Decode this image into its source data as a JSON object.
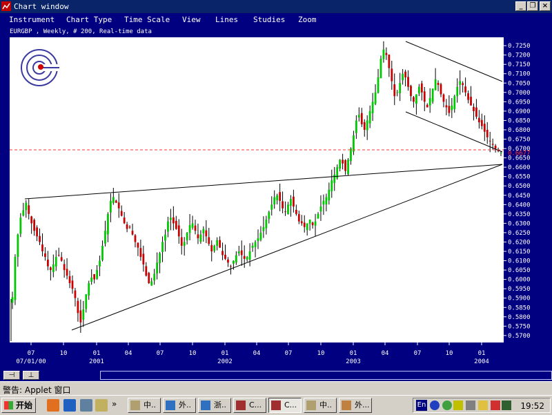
{
  "window": {
    "title": "Chart window"
  },
  "menu": [
    "Instrument",
    "Chart Type",
    "Time Scale",
    "View",
    "Lines",
    "Studies",
    "Zoom"
  ],
  "chart_info": "EURGBP , Weekly, # 200, Real-time data",
  "chart_data": {
    "type": "candlestick",
    "instrument": "EURGBP",
    "period": "Weekly",
    "bars": 200,
    "ylim": [
      0.567,
      0.728
    ],
    "y_ticks": [
      "0.7250",
      "0.7200",
      "0.7150",
      "0.7100",
      "0.7050",
      "0.7000",
      "0.6950",
      "0.6900",
      "0.6850",
      "0.6800",
      "0.6750",
      "0.6700",
      "0.6650",
      "0.6600",
      "0.6550",
      "0.6500",
      "0.6450",
      "0.6400",
      "0.6350",
      "0.6300",
      "0.6250",
      "0.6200",
      "0.6150",
      "0.6100",
      "0.6050",
      "0.6000",
      "0.5950",
      "0.5900",
      "0.5850",
      "0.5800",
      "0.5750",
      "0.5700"
    ],
    "x_ticks": [
      "07",
      "10",
      "01",
      "04",
      "07",
      "10",
      "01",
      "04",
      "07",
      "10",
      "01",
      "04",
      "07",
      "10",
      "01"
    ],
    "x_major": [
      "07/01/00",
      "2001",
      "2002",
      "2003",
      "2004"
    ],
    "current_price": "0.6677",
    "current_price_color": "#ff3030",
    "up_color": "#00c800",
    "down_color": "#c80000",
    "trendlines": "upper resistance, rising support, falling channel (2003-2004)",
    "closes": [
      0.5905,
      0.612,
      0.624,
      0.633,
      0.637,
      0.641,
      0.635,
      0.63,
      0.626,
      0.623,
      0.62,
      0.615,
      0.612,
      0.607,
      0.605,
      0.608,
      0.612,
      0.613,
      0.61,
      0.605,
      0.602,
      0.598,
      0.595,
      0.59,
      0.582,
      0.577,
      0.584,
      0.592,
      0.598,
      0.601,
      0.6,
      0.605,
      0.61,
      0.618,
      0.626,
      0.635,
      0.642,
      0.644,
      0.641,
      0.638,
      0.634,
      0.63,
      0.627,
      0.628,
      0.624,
      0.62,
      0.617,
      0.612,
      0.608,
      0.602,
      0.598,
      0.599,
      0.603,
      0.609,
      0.614,
      0.62,
      0.624,
      0.631,
      0.633,
      0.63,
      0.627,
      0.623,
      0.618,
      0.62,
      0.625,
      0.629,
      0.63,
      0.626,
      0.622,
      0.624,
      0.627,
      0.623,
      0.619,
      0.615,
      0.618,
      0.621,
      0.617,
      0.613,
      0.611,
      0.609,
      0.607,
      0.61,
      0.613,
      0.615,
      0.613,
      0.611,
      0.612,
      0.615,
      0.618,
      0.62,
      0.622,
      0.625,
      0.628,
      0.632,
      0.636,
      0.64,
      0.644,
      0.645,
      0.642,
      0.638,
      0.636,
      0.64,
      0.643,
      0.639,
      0.635,
      0.631,
      0.63,
      0.628,
      0.63,
      0.632,
      0.629,
      0.631,
      0.635,
      0.639,
      0.642,
      0.644,
      0.648,
      0.653,
      0.656,
      0.66,
      0.664,
      0.662,
      0.658,
      0.664,
      0.67,
      0.677,
      0.685,
      0.688,
      0.683,
      0.68,
      0.685,
      0.69,
      0.695,
      0.7,
      0.708,
      0.718,
      0.723,
      0.72,
      0.713,
      0.706,
      0.698,
      0.7,
      0.705,
      0.71,
      0.708,
      0.703,
      0.698,
      0.695,
      0.699,
      0.703,
      0.7,
      0.695,
      0.692,
      0.697,
      0.702,
      0.707,
      0.704,
      0.699,
      0.695,
      0.692,
      0.689,
      0.693,
      0.698,
      0.703,
      0.706,
      0.704,
      0.7,
      0.696,
      0.693,
      0.69,
      0.687,
      0.684,
      0.682,
      0.679,
      0.676,
      0.674,
      0.672,
      0.67,
      0.669,
      0.6677
    ]
  },
  "toolbar_bottom": [
    "⊣",
    "⊥"
  ],
  "status": "警告: Applet 窗口",
  "taskbar": {
    "start": "开始",
    "tasks": [
      "中..",
      "外..",
      "浙..",
      "C...",
      "C...",
      "中..",
      "外..."
    ],
    "tray_lang": "En",
    "clock": "19:52"
  },
  "colors": {
    "background": "#000080",
    "chart_bg": "#ffffff",
    "up": "#00c800",
    "down": "#c80000"
  }
}
